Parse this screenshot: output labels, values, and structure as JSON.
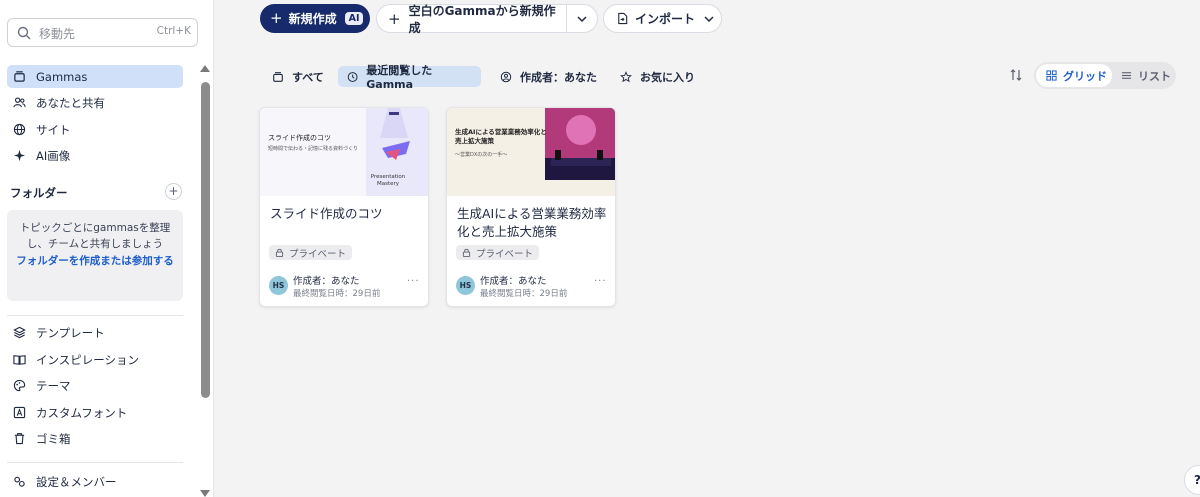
{
  "search": {
    "placeholder": "移動先",
    "shortcut": "Ctrl+K"
  },
  "sidebar": {
    "items": [
      {
        "label": "Gammas",
        "icon": "stack-icon"
      },
      {
        "label": "あなたと共有",
        "icon": "users-icon"
      },
      {
        "label": "サイト",
        "icon": "globe-icon"
      },
      {
        "label": "AI画像",
        "icon": "sparkle-icon"
      }
    ],
    "folders": {
      "heading": "フォルダー",
      "empty_text": "トピックごとにgammasを整理し、チームと共有しましょう",
      "create_link": "フォルダーを作成または参加する"
    },
    "bottom_items": [
      {
        "label": "テンプレート",
        "icon": "layers-icon"
      },
      {
        "label": "インスピレーション",
        "icon": "book-icon"
      },
      {
        "label": "テーマ",
        "icon": "palette-icon"
      },
      {
        "label": "カスタムフォント",
        "icon": "font-icon"
      },
      {
        "label": "ゴミ箱",
        "icon": "trash-icon"
      }
    ],
    "settings": {
      "label": "設定＆メンバー",
      "icon": "settings-icon"
    }
  },
  "toolbar": {
    "new_label": "新規作成",
    "ai_badge": "AI",
    "blank_label": "空白のGammaから新規作成",
    "import_label": "インポート"
  },
  "filters": {
    "tabs": [
      {
        "label": "すべて",
        "active": false
      },
      {
        "label": "最近閲覧したGamma",
        "active": true
      },
      {
        "label": "作成者：あなた",
        "active": false
      },
      {
        "label": "お気に入り",
        "active": false
      }
    ],
    "view": {
      "grid": "グリッド",
      "list": "リスト",
      "selected": "grid"
    }
  },
  "cards": [
    {
      "title": "スライド作成のコツ",
      "thumb_title": "スライド作成のコツ",
      "thumb_subtitle": "短時間で伝わる・記憶に残る資料づくり",
      "thumb_brand": "Presentation Mastery",
      "privacy": "プライベート",
      "avatar": "HS",
      "author": "作成者：あなた",
      "edited": "最終閲覧日時：29日前"
    },
    {
      "title": "生成AIによる営業業務効率化と売上拡大施策",
      "thumb_title": "生成AIによる営業業務効率化と売上拡大施策",
      "thumb_subtitle": "〜営業DXの次の一手〜",
      "privacy": "プライベート",
      "avatar": "HS",
      "author": "作成者：あなた",
      "edited": "最終閲覧日時：29日前"
    }
  ],
  "help": "?",
  "colors": {
    "primary": "#172a6b",
    "active_tab": "#d3e1f5",
    "link": "#1e5fcc",
    "avatar": "#8fc6d9"
  }
}
